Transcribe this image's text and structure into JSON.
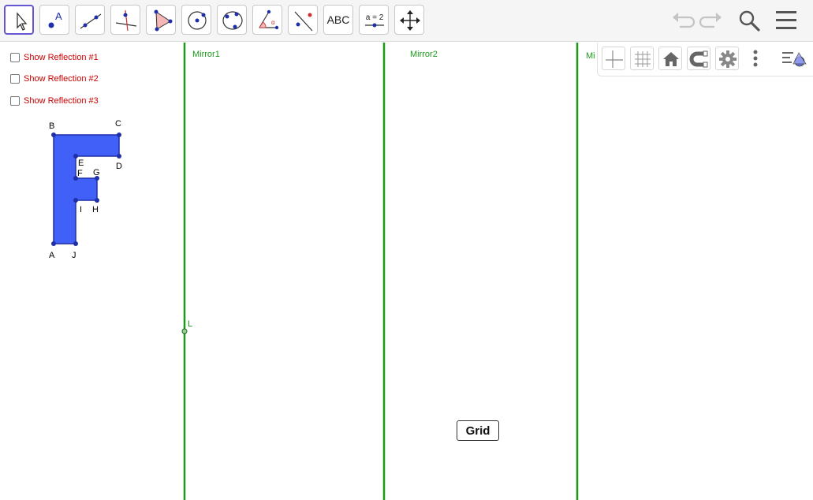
{
  "toolbar": {
    "text_tool_label": "ABC",
    "slider_tool_label": "a = 2"
  },
  "checkboxes": [
    {
      "label": "Show Reflection #1",
      "checked": false
    },
    {
      "label": "Show Reflection #2",
      "checked": false
    },
    {
      "label": "Show Reflection #3",
      "checked": false
    }
  ],
  "canvas": {
    "mirror1_label": "Mirror1",
    "mirror2_label": "Mirror2",
    "mirror3_label_visible": "Mi",
    "point_label": "L",
    "shape_points": [
      "A",
      "B",
      "C",
      "D",
      "E",
      "F",
      "G",
      "H",
      "I",
      "J"
    ],
    "grid_button_label": "Grid"
  },
  "colors": {
    "mirror": "#1a9a1a",
    "shape_fill": "#4060f8",
    "vertex": "#1f2fa8",
    "checkbox_label": "#cc0000",
    "selected_tool": "#6557d2"
  }
}
